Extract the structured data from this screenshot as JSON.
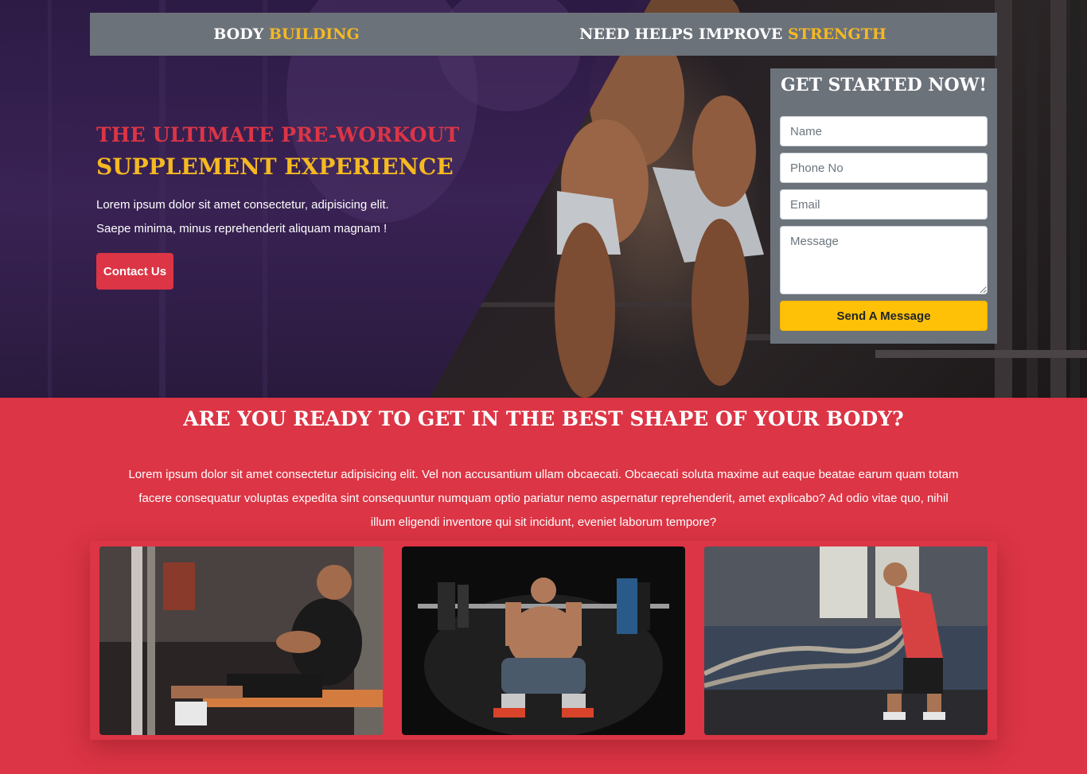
{
  "topbar": {
    "brand_part1": "BODY",
    "brand_part2": "BUILDING",
    "slogan_part1": "NEED HELPS IMPROVE",
    "slogan_part2": "STRENGTH"
  },
  "hero": {
    "title_line1": "THE ULTIMATE PRE-WORKOUT",
    "title_line2": "SUPPLEMENT EXPERIENCE",
    "lead_line1": "Lorem ipsum dolor sit amet consectetur, adipisicing elit.",
    "lead_line2": "Saepe minima, minus reprehenderit aliquam magnam !",
    "contact_label": "Contact Us"
  },
  "form": {
    "title": "GET STARTED NOW!",
    "name_placeholder": "Name",
    "phone_placeholder": "Phone No",
    "email_placeholder": "Email",
    "message_placeholder": "Message",
    "submit_label": "Send A Message"
  },
  "section": {
    "title": "ARE YOU READY TO GET IN THE BEST SHAPE OF YOUR BODY?",
    "text": "Lorem ipsum dolor sit amet consectetur adipisicing elit. Vel non accusantium ullam obcaecati. Obcaecati soluta maxime aut eaque beatae earum quam totam facere consequatur voluptas expedita sint consequuntur numquam optio pariatur nemo aspernatur reprehenderit, amet explicabo? Ad odio vitae quo, nihil illum eligendi inventore qui sit incidunt, eveniet laborum tempore?"
  },
  "colors": {
    "accent_red": "#dc3545",
    "accent_gold": "#f5b921",
    "panel_gray": "#6c727a",
    "button_yellow": "#ffc107",
    "hero_purple": "#2c1a45"
  }
}
